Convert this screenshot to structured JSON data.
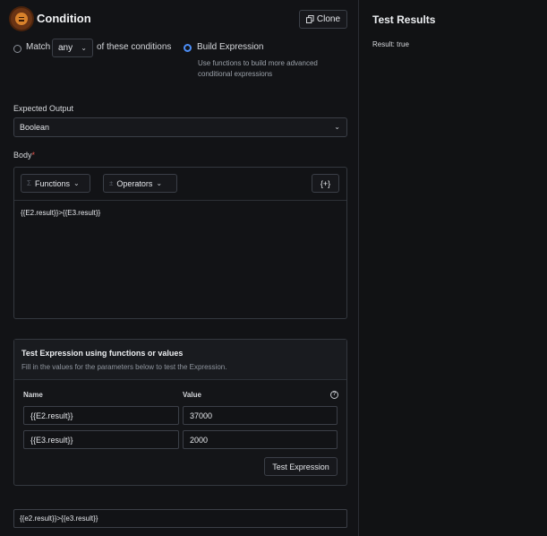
{
  "header": {
    "title": "Condition",
    "icon": "equals-circle-icon",
    "clone_label": "Clone"
  },
  "mode": {
    "match_label": "Match",
    "match_selected": "any",
    "conditions_label": "of these conditions",
    "build_label": "Build Expression",
    "build_help": "Use functions to build more advanced conditional expressions",
    "selected_mode": "build_expression"
  },
  "output": {
    "label": "Expected Output",
    "value": "Boolean"
  },
  "body": {
    "label": "Body",
    "required_mark": "*",
    "functions_label": "Functions",
    "operators_label": "Operators",
    "variables_label": "{+}",
    "expression": "{{E2.result}}>{{E3.result}}"
  },
  "test": {
    "title": "Test Expression using functions or values",
    "subtitle": "Fill in the values for the parameters below to test the Expression.",
    "name_header": "Name",
    "value_header": "Value",
    "params": [
      {
        "name": "{{E2.result}}",
        "value": "37000"
      },
      {
        "name": "{{E3.result}}",
        "value": "2000"
      }
    ],
    "button_label": "Test Expression",
    "evaluated_expression": "{{e2.result}}>{{e3.result}}"
  },
  "results": {
    "title": "Test Results",
    "value": "Result: true"
  },
  "colors": {
    "accent": "#4c8ef7",
    "icon_orange": "#d9822b",
    "background": "#121316"
  }
}
